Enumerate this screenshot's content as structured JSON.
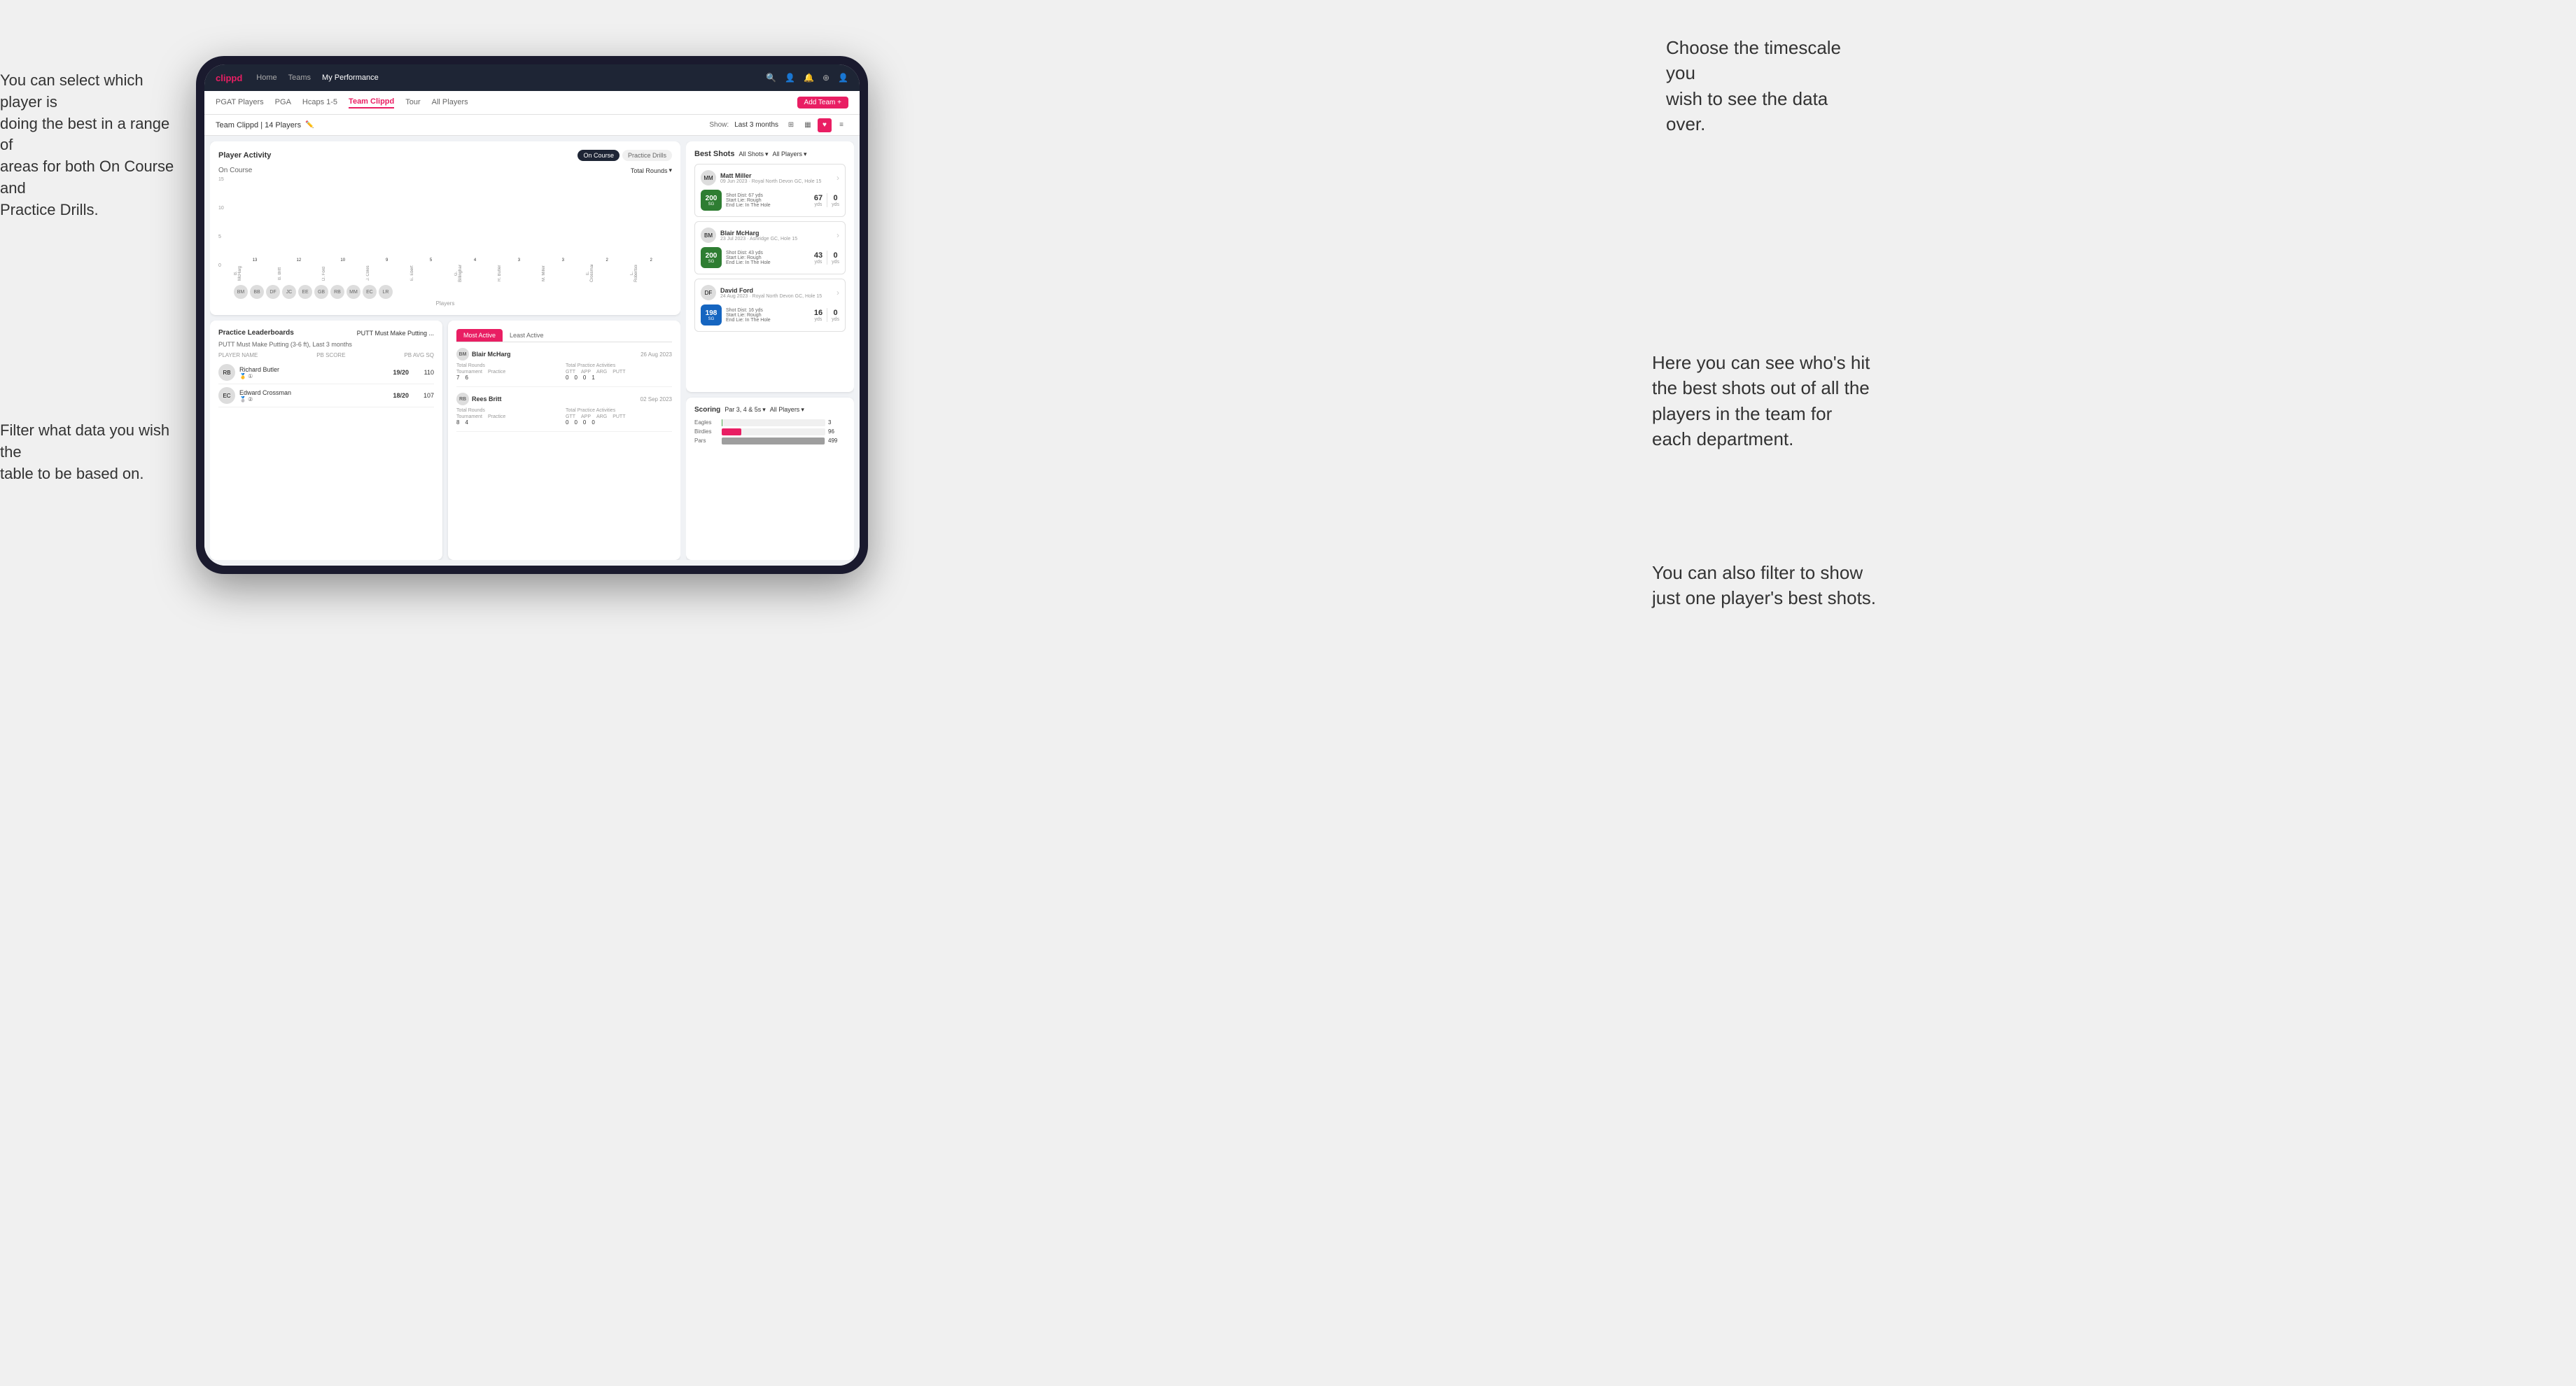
{
  "annotations": {
    "top_right": {
      "text": "Choose the timescale you\nwish to see the data over."
    },
    "top_left": {
      "text": "You can select which player is\ndoing the best in a range of\nareas for both On Course and\nPractice Drills."
    },
    "bottom_left": {
      "text": "Filter what data you wish the\ntable to be based on."
    },
    "bottom_right_top": {
      "text": "Here you can see who's hit\nthe best shots out of all the\nplayers in the team for\neach department."
    },
    "bottom_right_bottom": {
      "text": "You can also filter to show\njust one player's best shots."
    }
  },
  "nav": {
    "logo": "clippd",
    "links": [
      "Home",
      "Teams",
      "My Performance"
    ],
    "active": "My Performance"
  },
  "tabs": {
    "items": [
      "PGAT Players",
      "PGA",
      "Hcaps 1-5",
      "Team Clippd",
      "Tour",
      "All Players"
    ],
    "active": "Team Clippd",
    "add_button": "Add Team +"
  },
  "team_header": {
    "name": "Team Clippd | 14 Players",
    "show_label": "Show:",
    "time_filter": "Last 3 months",
    "view_modes": [
      "grid-4",
      "grid-3",
      "heart",
      "list"
    ]
  },
  "player_activity": {
    "title": "Player Activity",
    "toggle_options": [
      "On Course",
      "Practice Drills"
    ],
    "active_toggle": "On Course",
    "section_label": "On Course",
    "chart_dropdown": "Total Rounds",
    "y_axis_labels": [
      "0",
      "5",
      "10",
      "15"
    ],
    "players": [
      {
        "name": "B. McHarg",
        "value": 13,
        "initials": "BM"
      },
      {
        "name": "B. Britt",
        "value": 12,
        "initials": "BB"
      },
      {
        "name": "D. Ford",
        "value": 10,
        "initials": "DF"
      },
      {
        "name": "J. Coles",
        "value": 9,
        "initials": "JC"
      },
      {
        "name": "E. Ebert",
        "value": 5,
        "initials": "EE"
      },
      {
        "name": "G. Billingham",
        "value": 4,
        "initials": "GB"
      },
      {
        "name": "R. Butler",
        "value": 3,
        "initials": "RB"
      },
      {
        "name": "M. Miller",
        "value": 3,
        "initials": "MM"
      },
      {
        "name": "E. Crossman",
        "value": 2,
        "initials": "EC"
      },
      {
        "name": "L. Robertson",
        "value": 2,
        "initials": "LR"
      }
    ],
    "x_axis_label": "Players"
  },
  "practice_leaderboards": {
    "title": "Practice Leaderboards",
    "dropdown": "PUTT Must Make Putting ...",
    "subtitle": "PUTT Must Make Putting (3-6 ft), Last 3 months",
    "columns": [
      "Player Name",
      "PB Score",
      "PB Avg SQ"
    ],
    "players": [
      {
        "name": "Richard Butler",
        "initials": "RB",
        "rank": 1,
        "pb_score": "19/20",
        "pb_avg": "110"
      },
      {
        "name": "Edward Crossman",
        "initials": "EC",
        "rank": 2,
        "pb_score": "18/20",
        "pb_avg": "107"
      }
    ]
  },
  "most_active": {
    "tabs": [
      "Most Active",
      "Least Active"
    ],
    "active_tab": "Most Active",
    "players": [
      {
        "name": "Blair McHarg",
        "avatar": "BM",
        "date": "26 Aug 2023",
        "total_rounds_label": "Total Rounds",
        "tournament": 7,
        "practice": 6,
        "total_practice_label": "Total Practice Activities",
        "gtt": 0,
        "app": 0,
        "arg": 0,
        "putt": 1
      },
      {
        "name": "Rees Britt",
        "avatar": "RB",
        "date": "02 Sep 2023",
        "total_rounds_label": "Total Rounds",
        "tournament": 8,
        "practice": 4,
        "total_practice_label": "Total Practice Activities",
        "gtt": 0,
        "app": 0,
        "arg": 0,
        "putt": 0
      }
    ]
  },
  "best_shots": {
    "title": "Best Shots",
    "filter1": "All Shots",
    "filter2": "All Players",
    "shots": [
      {
        "player_name": "Matt Miller",
        "player_avatar": "MM",
        "detail": "09 Jun 2023 · Royal North Devon GC, Hole 15",
        "badge": "200",
        "badge_sub": "SG",
        "shot_dist": "Shot Dist: 67 yds",
        "start_lie": "Start Lie: Rough",
        "end_lie": "End Lie: In The Hole",
        "yds_value": "67",
        "yds_label": "yds",
        "zero_value": "0",
        "zero_label": "yds"
      },
      {
        "player_name": "Blair McHarg",
        "player_avatar": "BM",
        "detail": "23 Jul 2023 · Ashridge GC, Hole 15",
        "badge": "200",
        "badge_sub": "SG",
        "shot_dist": "Shot Dist: 43 yds",
        "start_lie": "Start Lie: Rough",
        "end_lie": "End Lie: In The Hole",
        "yds_value": "43",
        "yds_label": "yds",
        "zero_value": "0",
        "zero_label": "yds"
      },
      {
        "player_name": "David Ford",
        "player_avatar": "DF",
        "detail": "24 Aug 2023 · Royal North Devon GC, Hole 15",
        "badge": "198",
        "badge_sub": "SG",
        "shot_dist": "Shot Dist: 16 yds",
        "start_lie": "Start Lie: Rough",
        "end_lie": "End Lie: In The Hole",
        "yds_value": "16",
        "yds_label": "yds",
        "zero_value": "0",
        "zero_label": "yds"
      }
    ]
  },
  "scoring": {
    "title": "Scoring",
    "filter1": "Par 3, 4 & 5s",
    "filter2": "All Players",
    "bars": [
      {
        "label": "Eagles",
        "value": 3,
        "max": 500,
        "color": "#4caf50"
      },
      {
        "label": "Birdies",
        "value": 96,
        "max": 500,
        "color": "#e91e63"
      },
      {
        "label": "Pars",
        "value": 499,
        "max": 500,
        "color": "#9e9e9e"
      }
    ]
  }
}
